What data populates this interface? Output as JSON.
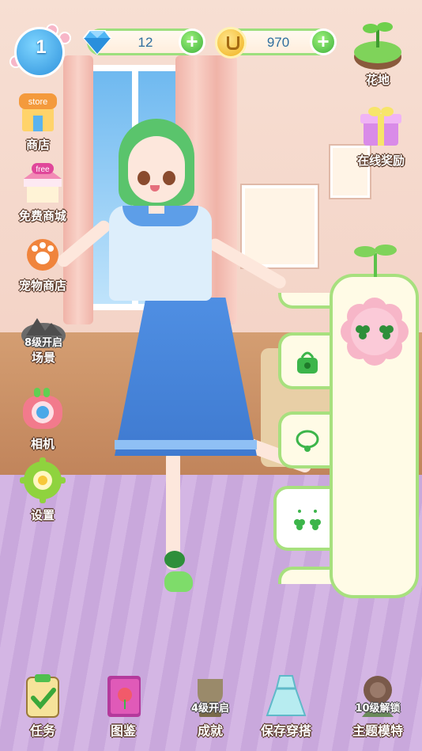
{
  "hud": {
    "level": "1",
    "gems": "12",
    "coins": "970",
    "add_gems_icon": "plus-icon",
    "add_coins_icon": "plus-icon"
  },
  "left_menu": [
    {
      "id": "store",
      "label": "商店",
      "icon": "store-icon",
      "badge": "store"
    },
    {
      "id": "free-mall",
      "label": "免费商城",
      "icon": "free-shop-icon",
      "badge": "free"
    },
    {
      "id": "pet-shop",
      "label": "宠物商店",
      "icon": "paw-icon"
    },
    {
      "id": "scene",
      "label": "场景",
      "icon": "scene-icon",
      "lock_text": "8级开启"
    },
    {
      "id": "camera",
      "label": "相机",
      "icon": "camera-icon"
    },
    {
      "id": "settings",
      "label": "设置",
      "icon": "gear-icon"
    }
  ],
  "right_menu": [
    {
      "id": "garden",
      "label": "花地",
      "icon": "garden-island-icon"
    },
    {
      "id": "online-reward",
      "label": "在线奖励",
      "icon": "gift-box-icon"
    }
  ],
  "bottom_bar": [
    {
      "id": "tasks",
      "label": "任务",
      "icon": "checklist-icon"
    },
    {
      "id": "album",
      "label": "图鉴",
      "icon": "album-book-icon"
    },
    {
      "id": "achievement",
      "label": "成就",
      "icon": "trophy-icon",
      "lock_text": "4级开启"
    },
    {
      "id": "save-outfit",
      "label": "保存穿搭",
      "icon": "dress-icon"
    },
    {
      "id": "theme-model",
      "label": "主题模特",
      "icon": "model-icon",
      "lock_text": "10级解锁"
    }
  ],
  "wardrobe_tabs": [
    "bag-icon",
    "necklace-icon",
    "earring-icon"
  ],
  "colors": {
    "panel_border": "#a7e07e",
    "accent_green": "#3fb23c",
    "resource_text": "#2e6e9e"
  }
}
